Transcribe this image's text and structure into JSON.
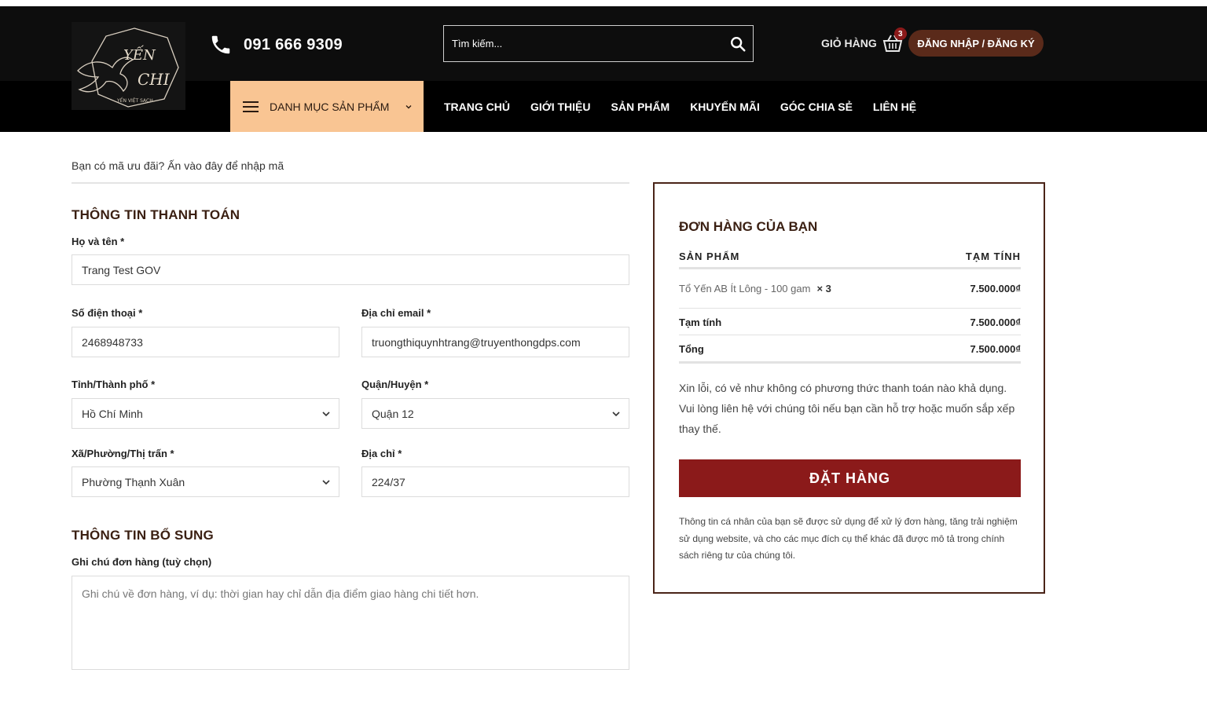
{
  "header": {
    "logo_text_top": "YẾN",
    "logo_text_bottom": "CHI",
    "logo_tagline": "YẾN VIỆT SẠCH",
    "phone": "091 666 9309",
    "search_placeholder": "Tìm kiếm...",
    "cart_label": "GIỎ HÀNG",
    "cart_count": "3",
    "login_label": "ĐĂNG NHẬP / ĐĂNG KÝ"
  },
  "nav": {
    "category_label": "DANH MỤC SẢN PHẨM",
    "items": [
      "TRANG CHỦ",
      "GIỚI THIỆU",
      "SẢN PHẨM",
      "KHUYẾN MÃI",
      "GÓC CHIA SẺ",
      "LIÊN HỆ"
    ]
  },
  "coupon": {
    "text": "Bạn có mã ưu đãi? Ấn vào đây để nhập mã"
  },
  "billing": {
    "title": "THÔNG TIN THANH TOÁN",
    "fullname_label": "Họ và tên *",
    "fullname_value": "Trang Test GOV",
    "phone_label": "Số điện thoại *",
    "phone_value": "2468948733",
    "email_label": "Địa chỉ email *",
    "email_value": "truongthiquynhtrang@truyenthongdps.com",
    "province_label": "Tỉnh/Thành phố *",
    "province_value": "Hồ Chí Minh",
    "district_label": "Quận/Huyện *",
    "district_value": "Quận 12",
    "ward_label": "Xã/Phường/Thị trấn *",
    "ward_value": "Phường Thạnh Xuân",
    "address_label": "Địa chỉ *",
    "address_value": "224/37"
  },
  "additional": {
    "title": "THÔNG TIN BỔ SUNG",
    "note_label": "Ghi chú đơn hàng (tuỳ chọn)",
    "note_placeholder": "Ghi chú về đơn hàng, ví dụ: thời gian hay chỉ dẫn địa điểm giao hàng chi tiết hơn."
  },
  "order": {
    "title": "ĐƠN HÀNG CỦA BẠN",
    "col_product": "SẢN PHẨM",
    "col_subtotal": "TẠM TÍNH",
    "item_name": "Tổ Yến AB Ít Lông - 100 gam",
    "item_qty": "× 3",
    "item_price": "7.500.000₫",
    "subtotal_label": "Tạm tính",
    "subtotal_value": "7.500.000₫",
    "total_label": "Tổng",
    "total_value": "7.500.000₫",
    "no_payment_msg": "Xin lỗi, có vẻ như không có phương thức thanh toán nào khả dụng. Vui lòng liên hệ với chúng tôi nếu bạn cần hỗ trợ hoặc muốn sắp xếp thay thế.",
    "place_order_label": "ĐẶT HÀNG",
    "privacy_text": "Thông tin cá nhân của bạn sẽ được sử dụng để xử lý đơn hàng, tăng trải nghiệm sử dụng website, và cho các mục đích cụ thể khác đã được mô tả trong chính sách riêng tư của chúng tôi."
  },
  "icons": {
    "phone": "phone-icon",
    "search": "search-icon",
    "cart": "basket-icon",
    "menu": "hamburger-icon",
    "dropdown": "chevron-down-icon"
  },
  "colors": {
    "header_bg": "#0d0d0d",
    "category_bg": "#f9c593",
    "accent": "#8b1a1a",
    "login_bg": "#5a2a1a",
    "title": "#3a1f12"
  }
}
